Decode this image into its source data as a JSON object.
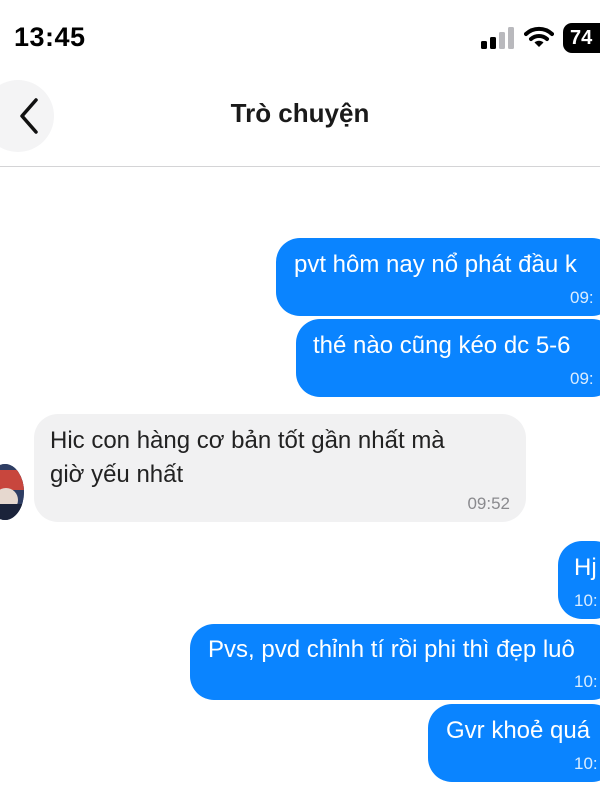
{
  "status_bar": {
    "time": "13:45",
    "battery": "74"
  },
  "header": {
    "title": "Trò chuyện",
    "back_icon": "chevron-left-icon"
  },
  "messages": [
    {
      "direction": "outgoing",
      "text": "pvt hôm nay nổ phát đầu k",
      "time": "09:"
    },
    {
      "direction": "outgoing",
      "text": "thé nào cũng kéo dc 5-6",
      "time": "09:"
    },
    {
      "direction": "incoming",
      "text_line1": "Hic con hàng cơ bản tốt gần nhất mà",
      "text_line2": "giờ yếu nhất",
      "time": "09:52"
    },
    {
      "direction": "outgoing",
      "text": "Hj",
      "time": "10:"
    },
    {
      "direction": "outgoing",
      "text": "Pvs, pvd chỉnh tí rồi phi thì đẹp luô",
      "time": "10:"
    },
    {
      "direction": "outgoing",
      "text": "Gvr khoẻ quá",
      "time": "10:"
    }
  ],
  "colors": {
    "outgoing_bubble": "#0a84ff",
    "incoming_bubble": "#f1f1f2"
  }
}
